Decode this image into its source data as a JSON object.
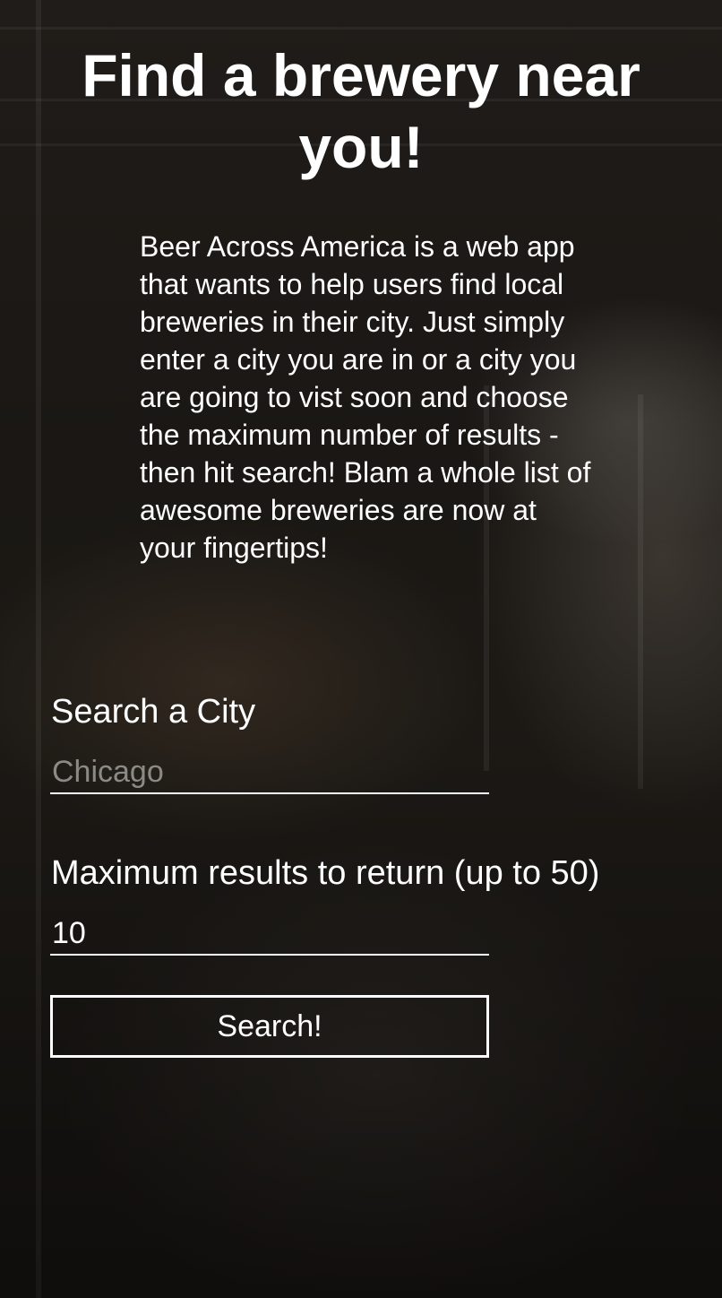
{
  "header": {
    "title": "Find a brewery near you!"
  },
  "intro": {
    "description": "Beer Across America is a web app that wants to help users find local breweries in their city. Just simply enter a city you are in or a city you are going to vist soon and choose the maximum number of results - then hit search! Blam a whole list of awesome breweries are now at your fingertips!"
  },
  "search_form": {
    "city_label": "Search a City",
    "city_placeholder": "Chicago",
    "city_value": "",
    "max_label": "Maximum results to return (up to 50)",
    "max_value": "10",
    "submit_label": "Search!"
  },
  "colors": {
    "text": "#ffffff",
    "placeholder": "#8c8a87",
    "background": "#1a1714"
  }
}
